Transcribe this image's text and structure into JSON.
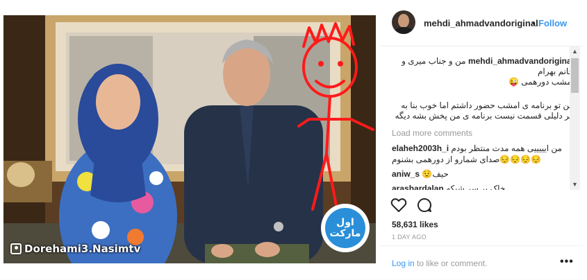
{
  "post": {
    "watermark": "Dorehami3.Nasimtv",
    "logo_text": "اول مارکت"
  },
  "header": {
    "username": "mehdi_ahmadvandoriginal",
    "separator": "•",
    "follow_label": "Follow"
  },
  "caption": {
    "username": "mehdi_ahmadvandoriginal",
    "line1": "من و جناب میری و",
    "line2": "خانم بهرام",
    "line3": "امشب دورهمی 😜",
    "paragraph2": "من تو برنامه ی امشب حضور داشتم اما خوب بنا به هر دلیلی قسمت نیست برنامه ی من پخش بشه دیگه"
  },
  "load_more_label": "Load more comments",
  "comments": [
    {
      "user": "elaheh2003h_i",
      "text": "من ایییییی همه مدت منتظر بودم 😔😔😔😔صدای شمارو از دورهمی بشنوم"
    },
    {
      "user": "aniw_s",
      "text": "حیف😟"
    },
    {
      "user": "arashardalan",
      "text": "خاک بر سر شبکه"
    }
  ],
  "actions": {
    "likes": "58,631 likes",
    "age": "1 DAY AGO"
  },
  "footer": {
    "login_link": "Log in",
    "login_rest": " to like or comment.",
    "more": "•••"
  },
  "icons": {
    "heart": "heart-icon",
    "comment": "comment-icon",
    "more": "more-options-icon",
    "watermark": "camera-icon"
  },
  "colors": {
    "link": "#3897f0",
    "muted": "#999999",
    "doodle": "#ff1a1a"
  }
}
